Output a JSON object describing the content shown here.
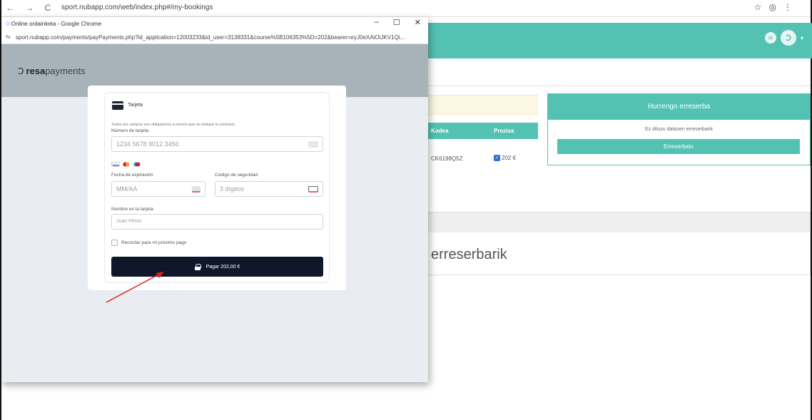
{
  "background_browser": {
    "url": "sport.nubapp.com/web/index.php#/my-bookings",
    "nav_glyphs": "← → C"
  },
  "background_page": {
    "table": {
      "headers": [
        "Kodea",
        "Prezioa"
      ],
      "rows": [
        {
          "code": "CK6198Q5Z",
          "price": "202 €"
        }
      ]
    },
    "next_booking_card": {
      "title": "Hurrengo erreserba",
      "empty_text": "Ez dituzu datozen erreserbarik",
      "button_label": "Erreserbatu"
    },
    "panel_text": "erreserbarik"
  },
  "popup": {
    "window_title": "Online ordainketa - Google Chrome",
    "url": "sport.nubapp.com/payments/payPayments.php?id_application=12003233&id_user=3138331&course%5B106353%5D=202&bearer=eyJ0eXAiOiJKV1Qi...",
    "logo": {
      "bold": "resa",
      "light": "payments"
    },
    "form": {
      "method_label": "Tarjeta",
      "required_note": "Todos los campos son obligatorios a menos que se indique lo contrario.",
      "card_number_label": "Número de tarjeta",
      "card_number_placeholder": "1234 5678 9012 3456",
      "brands": [
        "VISA",
        "MC",
        "MC"
      ],
      "expiry_label": "Fecha de expiración",
      "expiry_placeholder": "MM/AA",
      "cvc_label": "Código de seguridad",
      "cvc_placeholder": "3 dígitos",
      "name_label": "Nombre en la tarjeta",
      "name_placeholder": "Juan Pérez",
      "remember_label": "Recordar para mi próximo pago",
      "pay_button_label": "Pagar 202,00 €"
    }
  },
  "colors": {
    "accent": "#53c2b3",
    "pay_button": "#0f172b",
    "annotation_arrow": "#e02020"
  }
}
